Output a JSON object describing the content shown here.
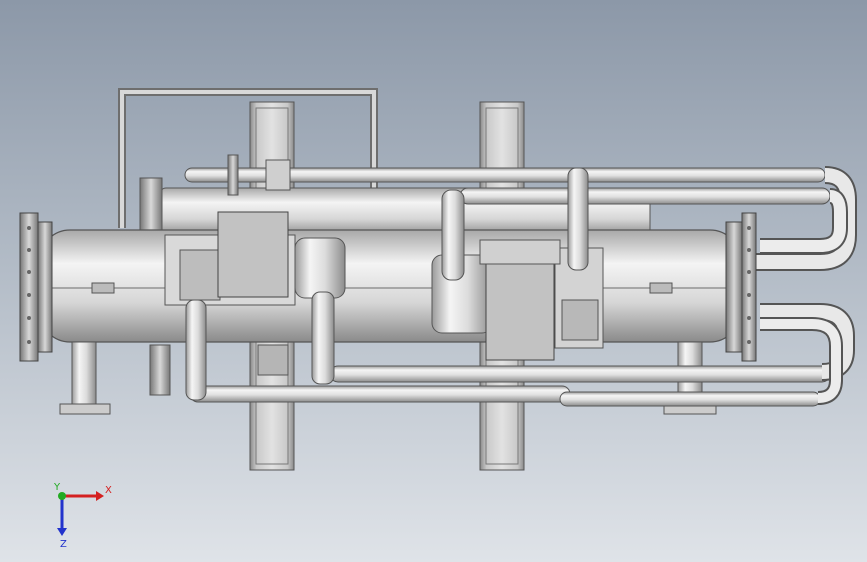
{
  "viewport": {
    "description_colors": {
      "background_top": "#8c98a8",
      "background_bottom": "#dfe3e8",
      "metal_light": "#f2f2f2",
      "metal_mid": "#c8c8c8",
      "metal_dark": "#8a8a8a",
      "frame": "#7d7d7d"
    }
  },
  "triad": {
    "x_label": "X",
    "y_label": "Y",
    "z_label": "Z",
    "x_color": "#d42020",
    "y_color": "#22aa22",
    "z_color": "#2233cc"
  },
  "model": {
    "name_icon": "chiller-assembly-3d-model"
  }
}
